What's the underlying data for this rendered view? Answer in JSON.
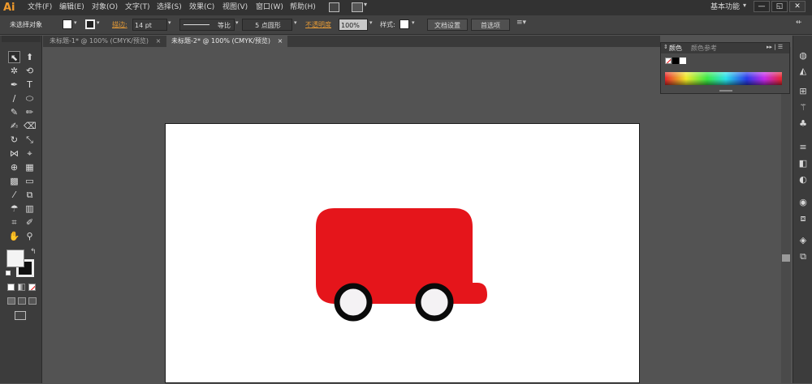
{
  "app": {
    "logo": "Ai",
    "workspace": "基本功能"
  },
  "menu": [
    "文件(F)",
    "编辑(E)",
    "对象(O)",
    "文字(T)",
    "选择(S)",
    "效果(C)",
    "视图(V)",
    "窗口(W)",
    "帮助(H)"
  ],
  "window_controls": {
    "minimize": "—",
    "restore": "◱",
    "close": "✕"
  },
  "control_bar": {
    "selection_label": "未选择对象",
    "stroke_label": "描边:",
    "stroke_weight": "14 pt",
    "stroke_profile": "等比",
    "brush": "5 点圆形",
    "opacity_label": "不透明度",
    "opacity_value": "100%",
    "style_label": "样式:",
    "doc_setup": "文档设置",
    "preferences": "首选项"
  },
  "tabs": [
    {
      "label": "未标题-1* @ 100% (CMYK/预览)",
      "close": "×",
      "active": false
    },
    {
      "label": "未标题-2* @ 100% (CMYK/预览)",
      "close": "×",
      "active": true
    }
  ],
  "color_panel": {
    "tab_color": "颜色",
    "tab_guide": "颜色参考",
    "menu_glyph": "▸▸ | ☰"
  },
  "colors": {
    "accent_orange": "#e59a36",
    "shape_red": "#e5151b",
    "wheel_fill": "#f4f2f4",
    "wheel_stroke": "#0a0a0a"
  }
}
